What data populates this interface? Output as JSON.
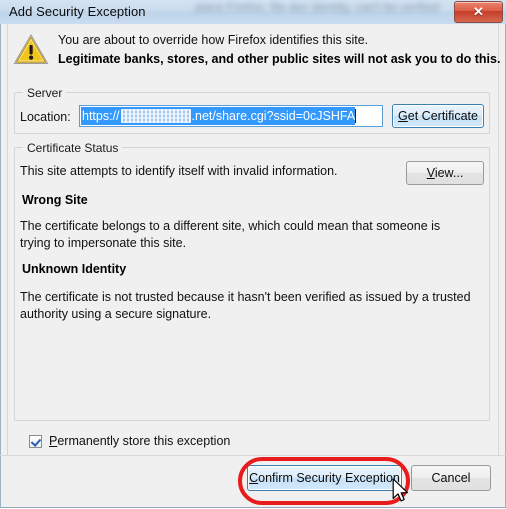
{
  "window": {
    "title": "Add Security Exception",
    "titlebar_background_text": "place Firefox, file dec identity, can't be verified",
    "close_button_label": "✕",
    "close_icon": "close-icon"
  },
  "header": {
    "warning_icon": "warning-triangle-icon",
    "line1": "You are about to override how Firefox identifies this site.",
    "line2": "Legitimate banks, stores, and other public sites will not ask you to do this."
  },
  "server_group": {
    "legend": "Server",
    "location_label": "Location:",
    "location_value_prefix": "https://",
    "location_value_redacted": "[redacted]",
    "location_value_suffix": ".net/share.cgi?ssid=0cJSHFA",
    "location_value_full": "https://[redacted].net/share.cgi?ssid=0cJSHFA",
    "get_certificate_label": "Get Certificate",
    "get_certificate_accesskey": "G"
  },
  "certificate_status_group": {
    "legend": "Certificate Status",
    "intro": "This site attempts to identify itself with invalid information.",
    "view_label": "View...",
    "view_accesskey": "V",
    "sections": [
      {
        "heading": "Wrong Site",
        "body": "The certificate belongs to a different site, which could mean that someone is trying to impersonate this site."
      },
      {
        "heading": "Unknown Identity",
        "body": "The certificate is not trusted because it hasn't been verified as issued by a trusted authority using a secure signature."
      }
    ]
  },
  "options": {
    "permanently_store_label": "Permanently store this exception",
    "permanently_store_accesskey": "P",
    "permanently_store_checked": true
  },
  "footer": {
    "confirm_label": "Confirm Security Exception",
    "confirm_accesskey": "C",
    "cancel_label": "Cancel"
  },
  "annotation": {
    "type": "red-oval-highlight",
    "target": "confirm-security-exception-button",
    "color": "#e81c1c"
  },
  "colors": {
    "titlebar": "#cbdcee",
    "dialog_background": "#f0f0f0",
    "selection_highlight": "#3399ff",
    "focus_border": "#3c7fb1",
    "annotation_red": "#e81c1c",
    "warning_yellow": "#f5c518",
    "close_red": "#d4543c"
  }
}
